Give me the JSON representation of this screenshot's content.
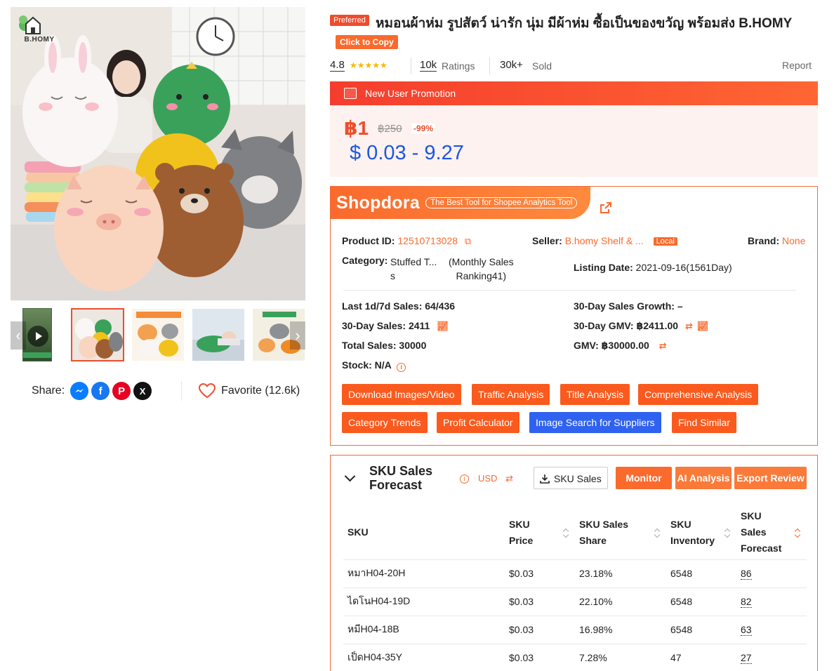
{
  "gallery": {
    "logo_text": "B.HOMY",
    "thumbnails": [
      "video",
      "image-1",
      "image-2",
      "image-3",
      "image-4"
    ],
    "active_thumbnail_index": 1
  },
  "share": {
    "label": "Share:",
    "networks": [
      "messenger-icon",
      "facebook-icon",
      "pinterest-icon",
      "x-icon"
    ],
    "favorite_label": "Favorite (12.6k)"
  },
  "product": {
    "preferred_badge": "Preferred",
    "title": "หมอนผ้าห่ม รูปสัตว์ น่ารัก นุ่ม มีผ้าห่ม ซื้อเป็นของขวัญ พร้อมส่ง B.HOMY",
    "copy_label": "Click to Copy",
    "rating": "4.8",
    "ratings_count": "10k",
    "ratings_label": "Ratings",
    "sold_count": "30k+",
    "sold_label": "Sold",
    "report_label": "Report",
    "stars_filled": 5
  },
  "promo": {
    "label": "New User Promotion",
    "price_now": "฿1",
    "price_old": "฿250",
    "discount": "-99%",
    "price_usd": "$ 0.03 - 9.27",
    "accent_color": "#ee4d2d"
  },
  "shopdora": {
    "logo": "Shopdora",
    "tagline": "The Best Tool for Shopee Analytics Tool",
    "product_id_label": "Product ID:",
    "product_id": "12510713028",
    "seller_label": "Seller:",
    "seller": "B.homy Shelf & ...",
    "seller_badge": "Local",
    "brand_label": "Brand:",
    "brand": "None",
    "category_label": "Category:",
    "category_line1": "Stuffed T...",
    "category_line2": "s",
    "ranking_line1": "(Monthly Sales",
    "ranking_line2": "Ranking41)",
    "listing_date_label": "Listing Date:",
    "listing_date": "2021-09-16(1561Day)",
    "sales_1d7d": "Last 1d/7d Sales: 64/436",
    "sales_30d": "30-Day Sales: 2411",
    "total_sales": "Total Sales: 30000",
    "stock": "Stock: N/A",
    "growth_30d": "30-Day Sales Growth: –",
    "gmv_30d": "30-Day GMV: ฿2411.00",
    "gmv": "GMV: ฿30000.00",
    "buttons": [
      "Download Images/Video",
      "Traffic Analysis",
      "Title Analysis",
      "Comprehensive Analysis",
      "Category Trends",
      "Profit Calculator",
      "Image Search for Suppliers",
      "Find Similar"
    ]
  },
  "sku": {
    "title_line1": "SKU Sales",
    "title_line2": "Forecast",
    "currency": "USD",
    "download_label": "SKU Sales",
    "monitor_label": "Monitor",
    "ai_label": "AI Analysis",
    "export_label": "Export Review",
    "columns": [
      "SKU",
      "SKU Price",
      "SKU Sales Share",
      "SKU Inventory",
      "SKU Sales Forecast"
    ],
    "col_head": {
      "sku": "SKU",
      "price_1": "SKU",
      "price_2": "Price",
      "share_1": "SKU Sales",
      "share_2": "Share",
      "inv_1": "SKU",
      "inv_2": "Inventory",
      "fc_1": "SKU",
      "fc_2": "Sales",
      "fc_3": "Forecast"
    },
    "rows": [
      {
        "sku": "หมาH04-20H",
        "price": "$0.03",
        "share": "23.18%",
        "inventory": "6548",
        "forecast": "86"
      },
      {
        "sku": "ไดโนH04-19D",
        "price": "$0.03",
        "share": "22.10%",
        "inventory": "6548",
        "forecast": "82"
      },
      {
        "sku": "หมีH04-18B",
        "price": "$0.03",
        "share": "16.98%",
        "inventory": "6548",
        "forecast": "63"
      },
      {
        "sku": "เป็ดH04-35Y",
        "price": "$0.03",
        "share": "7.28%",
        "inventory": "47",
        "forecast": "27"
      }
    ]
  }
}
